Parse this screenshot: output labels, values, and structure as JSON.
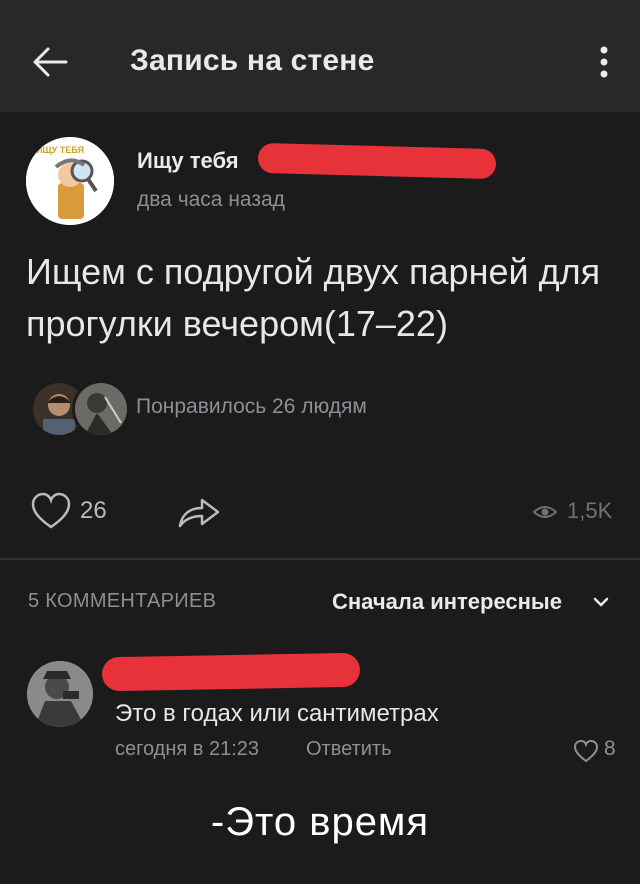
{
  "header": {
    "title": "Запись на стене",
    "back_icon": "arrow-left-icon",
    "menu_icon": "more-vertical-icon"
  },
  "post": {
    "author_name": "Ищу тебя",
    "author_avatar_text": "ИЩУ ТЕБЯ",
    "time": "два часа назад",
    "text": "Ищем с подругой двух парней для прогулки вечером(17–22)",
    "liked_by_text": "Понравилось 26 людям",
    "like_count": "26",
    "views": "1,5K"
  },
  "comments": {
    "count_label": "5 КОММЕНТАРИЕВ",
    "sort_label": "Сначала интересные",
    "items": [
      {
        "text": "Это в годах или сантиметрах",
        "time": "сегодня в 21:23",
        "reply_label": "Ответить",
        "likes": "8"
      }
    ]
  },
  "caption": "-Это время",
  "colors": {
    "background": "#1b1b1c",
    "header": "#28282a",
    "redaction": "#e8323a",
    "secondary_text": "#8c8f94"
  }
}
